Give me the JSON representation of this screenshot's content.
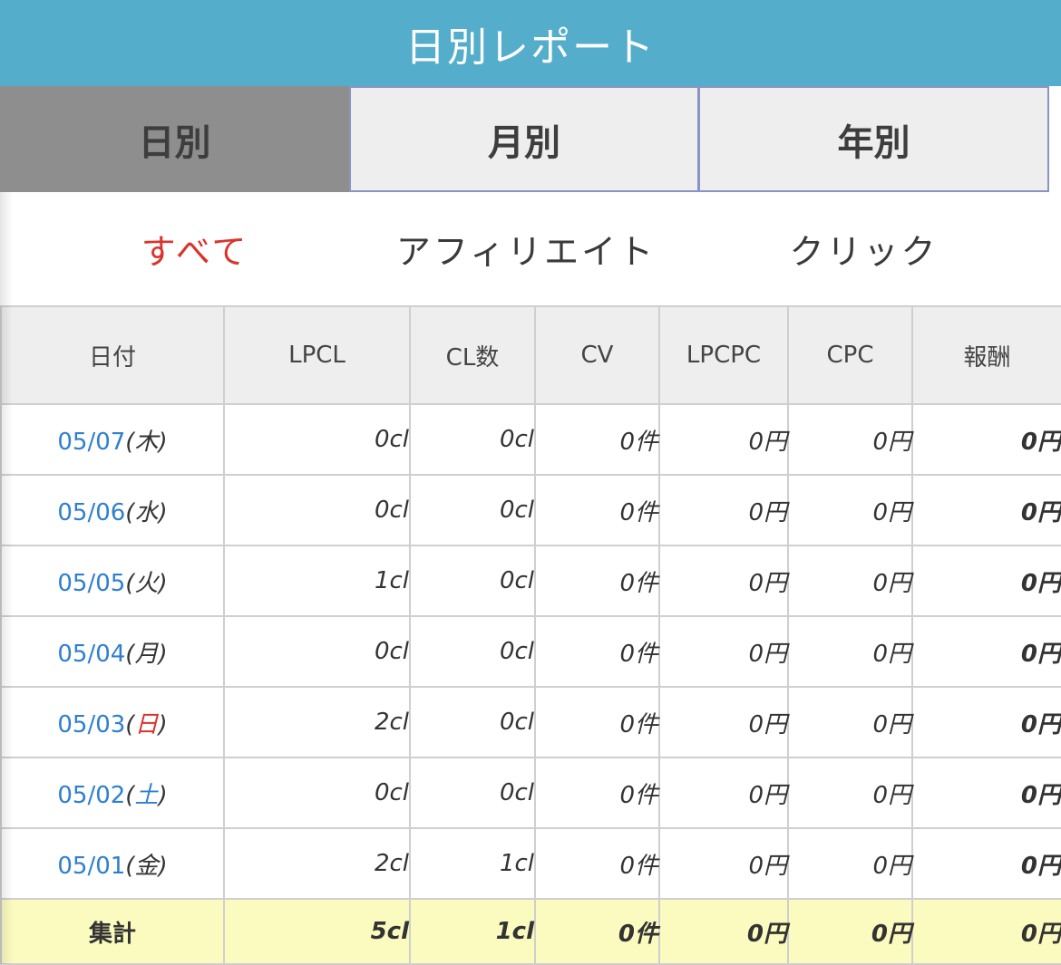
{
  "header": {
    "title": "日別レポート"
  },
  "period_tabs": [
    {
      "label": "日別",
      "active": true
    },
    {
      "label": "月別",
      "active": false
    },
    {
      "label": "年別",
      "active": false
    }
  ],
  "filter_tabs": [
    {
      "label": "すべて",
      "active": true
    },
    {
      "label": "アフィリエイト",
      "active": false
    },
    {
      "label": "クリック",
      "active": false
    }
  ],
  "colors": {
    "header_bg": "#54aecb",
    "active_tab_bg": "#8e8e8e",
    "active_filter": "#d9342b",
    "date_link": "#2f7fd0",
    "total_row_bg": "#fbfbc0"
  },
  "table": {
    "columns": [
      "日付",
      "LPCL",
      "CL数",
      "CV",
      "LPCPC",
      "CPC",
      "報酬"
    ],
    "rows": [
      {
        "date": "05/07",
        "dow": "木",
        "dow_type": "weekday",
        "lpcl": "0cl",
        "cl": "0cl",
        "cv": "0件",
        "lpcpc": "0円",
        "cpc": "0円",
        "reward": "0円"
      },
      {
        "date": "05/06",
        "dow": "水",
        "dow_type": "weekday",
        "lpcl": "0cl",
        "cl": "0cl",
        "cv": "0件",
        "lpcpc": "0円",
        "cpc": "0円",
        "reward": "0円"
      },
      {
        "date": "05/05",
        "dow": "火",
        "dow_type": "weekday",
        "lpcl": "1cl",
        "cl": "0cl",
        "cv": "0件",
        "lpcpc": "0円",
        "cpc": "0円",
        "reward": "0円"
      },
      {
        "date": "05/04",
        "dow": "月",
        "dow_type": "weekday",
        "lpcl": "0cl",
        "cl": "0cl",
        "cv": "0件",
        "lpcpc": "0円",
        "cpc": "0円",
        "reward": "0円"
      },
      {
        "date": "05/03",
        "dow": "日",
        "dow_type": "sunday",
        "lpcl": "2cl",
        "cl": "0cl",
        "cv": "0件",
        "lpcpc": "0円",
        "cpc": "0円",
        "reward": "0円"
      },
      {
        "date": "05/02",
        "dow": "土",
        "dow_type": "saturday",
        "lpcl": "0cl",
        "cl": "0cl",
        "cv": "0件",
        "lpcpc": "0円",
        "cpc": "0円",
        "reward": "0円"
      },
      {
        "date": "05/01",
        "dow": "金",
        "dow_type": "weekday",
        "lpcl": "2cl",
        "cl": "1cl",
        "cv": "0件",
        "lpcpc": "0円",
        "cpc": "0円",
        "reward": "0円"
      }
    ],
    "total": {
      "label": "集計",
      "lpcl": "5cl",
      "cl": "1cl",
      "cv": "0件",
      "lpcpc": "0円",
      "cpc": "0円",
      "reward": "0円"
    }
  }
}
